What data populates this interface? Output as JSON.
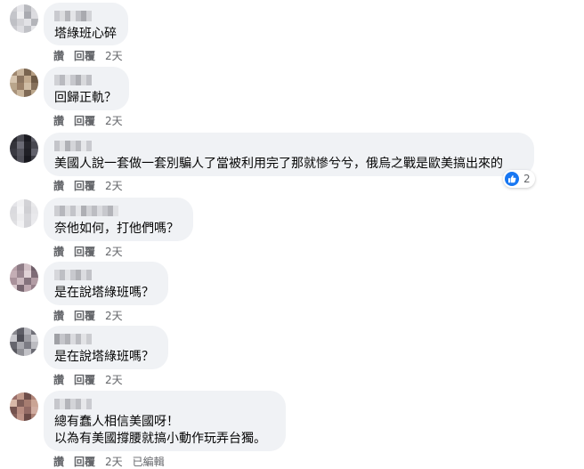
{
  "comments": [
    {
      "text_lines": [
        "塔綠班心碎"
      ],
      "actions": {
        "like": "讚",
        "reply": "回覆",
        "time": "2天"
      },
      "avatar_colors": [
        "#cfcfd3",
        "#e6e6ea",
        "#b8b9be",
        "#d9d9dd",
        "#c4c5ca",
        "#eeeef0",
        "#a9aab0",
        "#dcdce0",
        "#bfc0c5",
        "#d3d3d7",
        "#e2e2e6",
        "#b4b5ba",
        "#cacacf",
        "#dedee2",
        "#c0c1c6",
        "#e8e8eb"
      ]
    },
    {
      "text_lines": [
        "回歸正軌？"
      ],
      "actions": {
        "like": "讚",
        "reply": "回覆",
        "time": "2天"
      },
      "avatar_colors": [
        "#a08870",
        "#c8b49c",
        "#7a6550",
        "#b59d82",
        "#d6c4ae",
        "#8c7560",
        "#c2aa8e",
        "#6e5a46",
        "#b9a58b",
        "#9a8068",
        "#d0bda5",
        "#85705b",
        "#a8927a",
        "#c9b59b",
        "#7f6a55",
        "#bca78c"
      ]
    },
    {
      "text_lines": [
        "美國人說一套做一套別騙人了當被利用完了那就慘兮兮，俄烏之戰是歐美搞出來的"
      ],
      "actions": {
        "like": "讚",
        "reply": "回覆",
        "time": "2天"
      },
      "reaction_count": "2",
      "avatar_colors": [
        "#2a2a30",
        "#4a4a52",
        "#1c1c22",
        "#5c5c66",
        "#33333a",
        "#6b6b75",
        "#25252b",
        "#484850",
        "#3a3a42",
        "#55555e",
        "#202026",
        "#62626c",
        "#2e2e35",
        "#4f4f58",
        "#18181e",
        "#3f3f47"
      ]
    },
    {
      "text_lines": [
        "奈他如何，打他們嗎？"
      ],
      "actions": {
        "like": "讚",
        "reply": "回覆",
        "time": "2天"
      },
      "avatar_colors": [
        "#e4e4e8",
        "#f0f0f2",
        "#d2d2d6",
        "#eaeaec",
        "#dadade",
        "#f4f4f6",
        "#cfcfd3",
        "#e6e6e9",
        "#dcdcdf",
        "#eeeef0",
        "#d6d6da",
        "#e9e9ec",
        "#e0e0e3",
        "#f2f2f4",
        "#d4d4d8",
        "#ebebee"
      ]
    },
    {
      "text_lines": [
        "是在說塔綠班嗎？"
      ],
      "actions": {
        "like": "讚",
        "reply": "回覆",
        "time": "2天"
      },
      "avatar_colors": [
        "#b7a0a8",
        "#8e7c86",
        "#d2c0c6",
        "#6f5f69",
        "#c4aeb5",
        "#9a8690",
        "#e0d2d6",
        "#7e6c76",
        "#a9929b",
        "#cbb8be",
        "#85737d",
        "#b29ca4",
        "#d8c8cd",
        "#76656f",
        "#bea8b0",
        "#957f89"
      ]
    },
    {
      "text_lines": [
        "是在說塔綠班嗎？"
      ],
      "actions": {
        "like": "讚",
        "reply": "回覆",
        "time": "2天"
      },
      "avatar_colors": [
        "#8a8a90",
        "#5e5e66",
        "#b4b4ba",
        "#707078",
        "#c8c8cd",
        "#4e4e56",
        "#9c9ca2",
        "#d4d4d8",
        "#66666e",
        "#a8a8ae",
        "#7c7c84",
        "#bcbcc1",
        "#58585f",
        "#909096",
        "#c2c2c7",
        "#6a6a72"
      ]
    },
    {
      "text_lines": [
        "總有蠢人相信美國呀！",
        "以為有美國撐腰就搞小動作玩弄台獨。"
      ],
      "actions": {
        "like": "讚",
        "reply": "回覆",
        "time": "2天",
        "edited": "已編輯"
      },
      "avatar_colors": [
        "#9a6f6a",
        "#c29a8c",
        "#6e4e4a",
        "#b08478",
        "#d8b8a8",
        "#805e58",
        "#a67c70",
        "#caa494",
        "#74524e",
        "#b88c80",
        "#926a64",
        "#d0aca0",
        "#845f5a",
        "#be9488",
        "#6a4a46",
        "#ac8276"
      ]
    }
  ]
}
